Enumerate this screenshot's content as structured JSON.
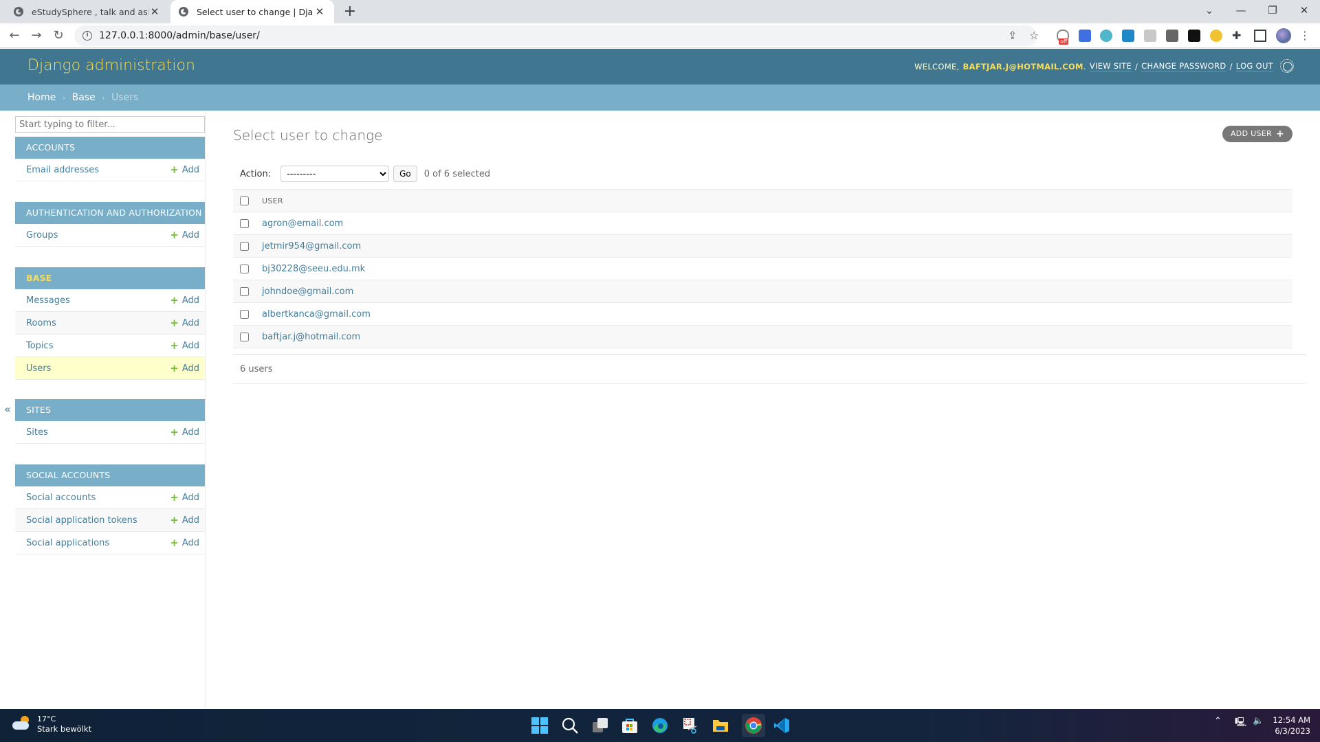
{
  "browser": {
    "tabs": [
      {
        "title": "eStudySphere , talk and ask abou",
        "active": false
      },
      {
        "title": "Select user to change | Django si",
        "active": true
      }
    ],
    "new_tab": "+",
    "url": "127.0.0.1:8000/admin/base/user/",
    "window_controls": {
      "dropdown": "⌄",
      "minimize": "—",
      "restore": "❐",
      "close": "✕"
    },
    "extension_badge": "off"
  },
  "header": {
    "brand": "Django administration",
    "welcome": "WELCOME,",
    "username": "BAFTJAR.J@HOTMAIL.COM",
    "username_suffix": ".",
    "view_site": "VIEW SITE",
    "change_password": "CHANGE PASSWORD",
    "log_out": "LOG OUT",
    "separator": "/"
  },
  "breadcrumbs": {
    "items": [
      "Home",
      "Base",
      "Users"
    ],
    "separator": "›"
  },
  "sidebar": {
    "filter_placeholder": "Start typing to filter...",
    "add_label": "Add",
    "collapse_label": "«",
    "modules": [
      {
        "title": "ACCOUNTS",
        "current": false,
        "models": [
          {
            "name": "Email addresses",
            "current": false
          }
        ]
      },
      {
        "title": "AUTHENTICATION AND AUTHORIZATION",
        "current": false,
        "models": [
          {
            "name": "Groups",
            "current": false
          }
        ]
      },
      {
        "title": "BASE",
        "current": true,
        "models": [
          {
            "name": "Messages",
            "current": false
          },
          {
            "name": "Rooms",
            "current": false
          },
          {
            "name": "Topics",
            "current": false
          },
          {
            "name": "Users",
            "current": true
          }
        ]
      },
      {
        "title": "SITES",
        "current": false,
        "models": [
          {
            "name": "Sites",
            "current": false
          }
        ]
      },
      {
        "title": "SOCIAL ACCOUNTS",
        "current": false,
        "models": [
          {
            "name": "Social accounts",
            "current": false
          },
          {
            "name": "Social application tokens",
            "current": false
          },
          {
            "name": "Social applications",
            "current": false
          }
        ]
      }
    ]
  },
  "main": {
    "title": "Select user to change",
    "add_button": "ADD USER",
    "add_button_icon": "+",
    "action_label": "Action:",
    "action_selected": "---------",
    "go_label": "Go",
    "selection_count": "0 of 6 selected",
    "column_header": "USER",
    "users": [
      "agron@email.com",
      "jetmir954@gmail.com",
      "bj30228@seeu.edu.mk",
      "johndoe@gmail.com",
      "albertkanca@gmail.com",
      "baftjar.j@hotmail.com"
    ],
    "result_count": "6 users"
  },
  "taskbar": {
    "temperature": "17°C",
    "weather": "Stark bewölkt",
    "time": "12:54 AM",
    "date": "6/3/2023"
  },
  "colors": {
    "header_bg": "#417690",
    "breadcrumb_bg": "#79aec8",
    "brand_yellow": "#f5dd5d",
    "link": "#447e9b",
    "add_green": "#70bf2b",
    "current_row": "#ffffcc"
  }
}
